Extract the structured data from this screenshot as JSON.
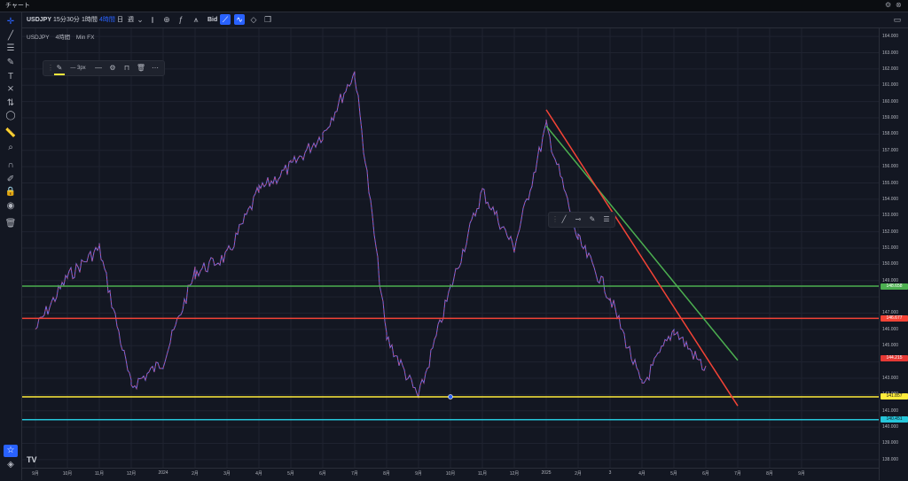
{
  "window": {
    "title": "チャート",
    "controls": [
      "gear-icon",
      "close-icon"
    ]
  },
  "toolbar": {
    "symbol": "USDJPY",
    "intervals": [
      "15分",
      "30分",
      "1時間",
      "4時間",
      "日",
      "週"
    ],
    "active_interval": "4時間",
    "bid_label": "Bid"
  },
  "legend": {
    "symbol": "USDJPY",
    "interval": "4時間",
    "source": "Min FX"
  },
  "drawing_toolbar": {
    "width_label": "3px"
  },
  "y_axis_ticks": [
    "164.000",
    "163.000",
    "162.000",
    "161.000",
    "160.000",
    "159.000",
    "158.000",
    "157.000",
    "156.000",
    "155.000",
    "154.000",
    "153.000",
    "152.000",
    "151.000",
    "150.000",
    "149.000",
    "147.000",
    "146.000",
    "145.000",
    "143.000",
    "142.000",
    "141.000",
    "140.000",
    "139.000",
    "138.000"
  ],
  "price_labels": [
    {
      "value": "148.658",
      "color": "#4caf50",
      "text_color": "#ffffff"
    },
    {
      "value": "146.677",
      "color": "#f44336",
      "text_color": "#ffffff"
    },
    {
      "value": "144.215",
      "color": "#e53935",
      "text_color": "#ffffff"
    },
    {
      "value": "141.857",
      "color": "#ffeb3b",
      "text_color": "#131722"
    },
    {
      "value": "140.451",
      "color": "#26c6da",
      "text_color": "#131722"
    }
  ],
  "x_axis_ticks": [
    "9月",
    "10月",
    "11月",
    "12月",
    "2024",
    "2月",
    "3月",
    "4月",
    "5月",
    "6月",
    "7月",
    "8月",
    "9月",
    "10月",
    "11月",
    "12月",
    "2025",
    "2月",
    "3",
    "4月",
    "5月",
    "6月",
    "7月",
    "8月",
    "9月"
  ],
  "chart_data": {
    "type": "line",
    "series": [
      {
        "x": [
          "2023-09",
          "2023-10",
          "2023-11",
          "2023-12",
          "2024-01",
          "2024-02",
          "2024-03",
          "2024-04",
          "2024-05",
          "2024-06",
          "2024-07",
          "2024-08",
          "2024-09",
          "2024-10",
          "2024-11",
          "2024-12",
          "2025-01",
          "2025-02",
          "2025-03",
          "2025-04",
          "2025-05",
          "2025-06"
        ],
        "values": [
          146.0,
          149.2,
          151.0,
          142.5,
          144.0,
          149.5,
          150.5,
          154.5,
          156.0,
          158.0,
          161.8,
          145.5,
          141.8,
          148.5,
          154.5,
          151.0,
          158.5,
          151.5,
          148.0,
          142.5,
          146.0,
          143.5
        ]
      }
    ],
    "horizontal_lines": [
      {
        "price": 148.658,
        "color": "#4caf50"
      },
      {
        "price": 146.677,
        "color": "#f44336"
      },
      {
        "price": 141.857,
        "color": "#ffeb3b"
      },
      {
        "price": 140.451,
        "color": "#26c6da"
      }
    ],
    "trend_lines": [
      {
        "color": "#4caf50",
        "from": [
          "2025-01",
          158.5
        ],
        "to": [
          "2025-07",
          144.1
        ]
      },
      {
        "color": "#f44336",
        "from": [
          "2025-01",
          159.5
        ],
        "to": [
          "2025-07",
          141.3
        ]
      }
    ],
    "ylim": [
      137.5,
      164.5
    ]
  }
}
